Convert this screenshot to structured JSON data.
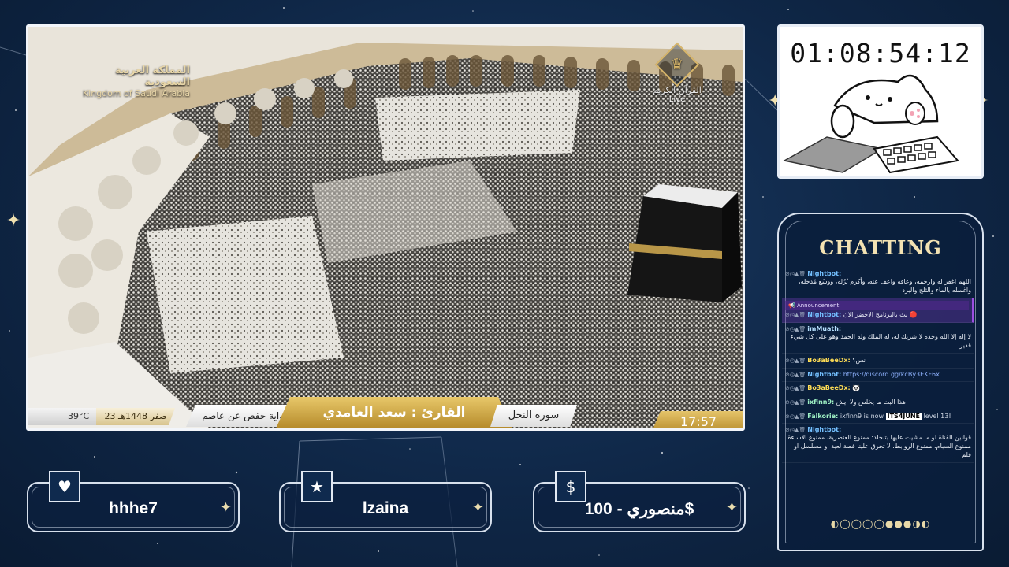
{
  "video": {
    "channel_ar": "المملكة العربية السعودية",
    "channel_en": "Kingdom of Saudi Arabia",
    "quran_channel": "القرآن الكريم",
    "live": "Live",
    "temperature": "39°C",
    "hijri_date": "23 صفر 1448هـ",
    "riwaya": "رواية حفص عن عاصم",
    "reciter": "القارئ : سعد الغامدي",
    "surah": "سورة النحل",
    "time": "17:57"
  },
  "timer": {
    "value": "01:08:54:12"
  },
  "chat": {
    "title": "CHATTING",
    "messages": [
      {
        "name": "Nightbot:",
        "color": "#74c0ff",
        "text": "اللهم اغفر له وارحمه، وعافه واعف عنه، وأكرم نُزُله، ووسّع مُدخله، واغسله بالماء والثلج والبرد"
      },
      {
        "announcement": "Announcement",
        "name": "Nightbot:",
        "color": "#74c0ff",
        "text": "بث بالبرنامج الاخضر الان 🔴"
      },
      {
        "name": "imMuath:",
        "color": "#b7e1ff",
        "text": "لا إله إلا الله وحده لا شريك له، له الملك وله الحمد وهو على كل شيء قدير"
      },
      {
        "name": "Bo3aBeeDx:",
        "color": "#ffdd55",
        "text": "نس؟"
      },
      {
        "name": "Nightbot:",
        "color": "#74c0ff",
        "text": "https://discord.gg/kcBy3EKF6x",
        "is_link": true
      },
      {
        "name": "Bo3aBeeDx:",
        "color": "#ffdd55",
        "text": "🐼"
      },
      {
        "name": "ixfinn9:",
        "color": "#9ef0c4",
        "text": "هذا البث ما يخلص ولا ايش"
      },
      {
        "name": "Falkorie:",
        "color": "#9ef0c4",
        "text_pre": "ixfinn9 is now ",
        "badge": "ITS4JUNE",
        "text_post": " level 13!"
      },
      {
        "name": "Nightbot:",
        "color": "#74c0ff",
        "text": "قوانين القناة لو ما مشيت عليها بتنجلد: ممنوع العنصرية، ممنوع الاساءة، ممنوع السبام، ممنوع الروابط، لا تحرق علينا قصة لعبة او مسلسل او فلم"
      }
    ],
    "dots": "◐◯◯◯◯●●●◑◐"
  },
  "stats": [
    {
      "icon": "heart-icon",
      "symbol": "♥",
      "value": "hhhe7"
    },
    {
      "icon": "star-icon",
      "symbol": "★",
      "value": "lzaina"
    },
    {
      "icon": "dollar-icon",
      "symbol": "$",
      "value": "منصوري - 100$"
    }
  ]
}
